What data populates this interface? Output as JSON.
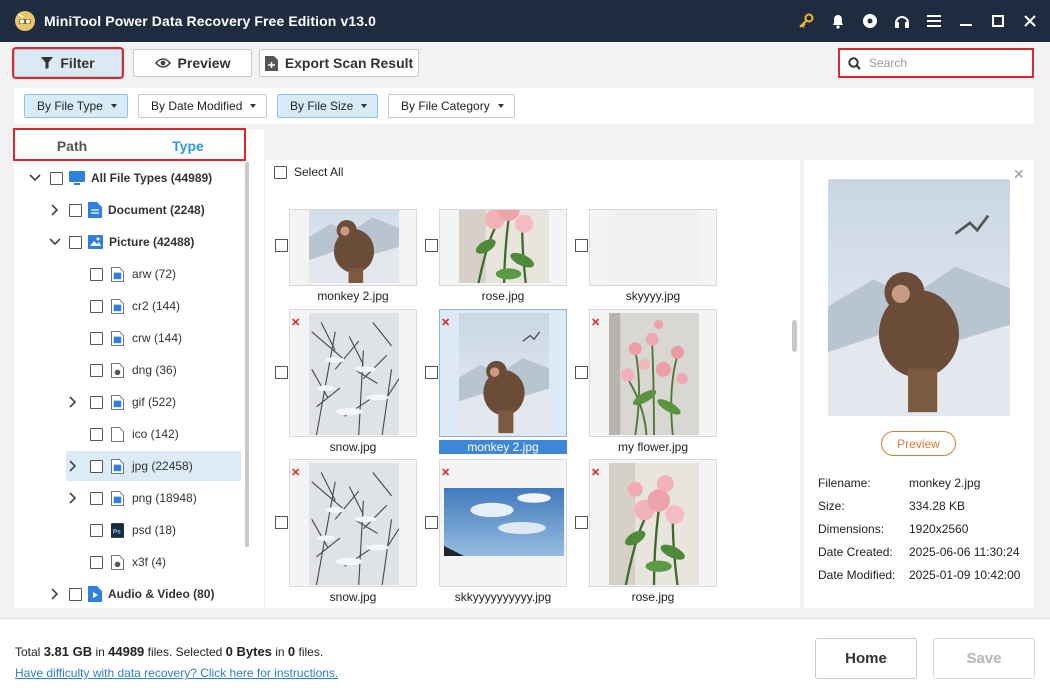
{
  "window": {
    "title": "MiniTool Power Data Recovery Free Edition v13.0",
    "controls": [
      "key-icon",
      "bell-icon",
      "disc-icon",
      "headphones-icon",
      "menu-icon",
      "minimize-icon",
      "maximize-icon",
      "close-icon"
    ]
  },
  "toolbar": {
    "filter_label": "Filter",
    "preview_label": "Preview",
    "export_label": "Export Scan Result",
    "search_placeholder": "Search"
  },
  "filters": {
    "by_file_type": "By File Type",
    "by_date_modified": "By Date Modified",
    "by_file_size": "By File Size",
    "by_file_category": "By File Category"
  },
  "tabs": {
    "path": "Path",
    "type": "Type",
    "active": "Type"
  },
  "tree": {
    "all": "All File Types (44989)",
    "document": "Document (2248)",
    "picture": "Picture (42488)",
    "items": [
      {
        "label": "arw (72)",
        "icon": "image-file-icon",
        "expandable": false
      },
      {
        "label": "cr2 (144)",
        "icon": "image-file-icon",
        "expandable": false
      },
      {
        "label": "crw (144)",
        "icon": "image-file-icon",
        "expandable": false
      },
      {
        "label": "dng (36)",
        "icon": "camera-file-icon",
        "expandable": false
      },
      {
        "label": "gif (522)",
        "icon": "image-file-icon",
        "expandable": true
      },
      {
        "label": "ico (142)",
        "icon": "blank-file-icon",
        "expandable": false
      },
      {
        "label": "jpg (22458)",
        "icon": "image-file-icon",
        "expandable": true,
        "selected": true
      },
      {
        "label": "png (18948)",
        "icon": "image-file-icon",
        "expandable": true
      },
      {
        "label": "psd (18)",
        "icon": "photoshop-file-icon",
        "expandable": false
      },
      {
        "label": "x3f (4)",
        "icon": "camera-file-icon",
        "expandable": false
      }
    ],
    "audio_video": "Audio & Video (80)"
  },
  "grid": {
    "select_all": "Select All",
    "files": [
      {
        "name": "monkey 2.jpg",
        "deleted": false,
        "selected": false
      },
      {
        "name": "rose.jpg",
        "deleted": false,
        "selected": false
      },
      {
        "name": "skyyyy.jpg",
        "deleted": false,
        "selected": false
      },
      {
        "name": "snow.jpg",
        "deleted": true,
        "selected": false
      },
      {
        "name": "monkey 2.jpg",
        "deleted": true,
        "selected": true
      },
      {
        "name": "my flower.jpg",
        "deleted": true,
        "selected": false
      },
      {
        "name": "snow.jpg",
        "deleted": true,
        "selected": false
      },
      {
        "name": "skkyyyyyyyyyy.jpg",
        "deleted": true,
        "selected": false
      },
      {
        "name": "rose.jpg",
        "deleted": true,
        "selected": false
      }
    ]
  },
  "preview": {
    "button": "Preview",
    "filename_label": "Filename:",
    "filename": "monkey 2.jpg",
    "size_label": "Size:",
    "size": "334.28 KB",
    "dimensions_label": "Dimensions:",
    "dimensions": "1920x2560",
    "created_label": "Date Created:",
    "created": "2025-06-06 11:30:24",
    "modified_label": "Date Modified:",
    "modified": "2025-01-09 10:42:00"
  },
  "status": {
    "total_prefix": "Total ",
    "total_size": "3.81 GB",
    "in1": " in ",
    "total_files": "44989",
    "files_sel": " files.  Selected ",
    "selected_size": "0 Bytes",
    "in2": " in ",
    "selected_files": "0",
    "files_end": " files.",
    "help_link": "Have difficulty with data recovery? Click here for instructions."
  },
  "bottom": {
    "home": "Home",
    "save": "Save"
  },
  "colors": {
    "titlebar": "#1f2b3e",
    "accent": "#2a9be0",
    "highlight_outline": "#e0262b",
    "preview_orange": "#e07a36"
  }
}
